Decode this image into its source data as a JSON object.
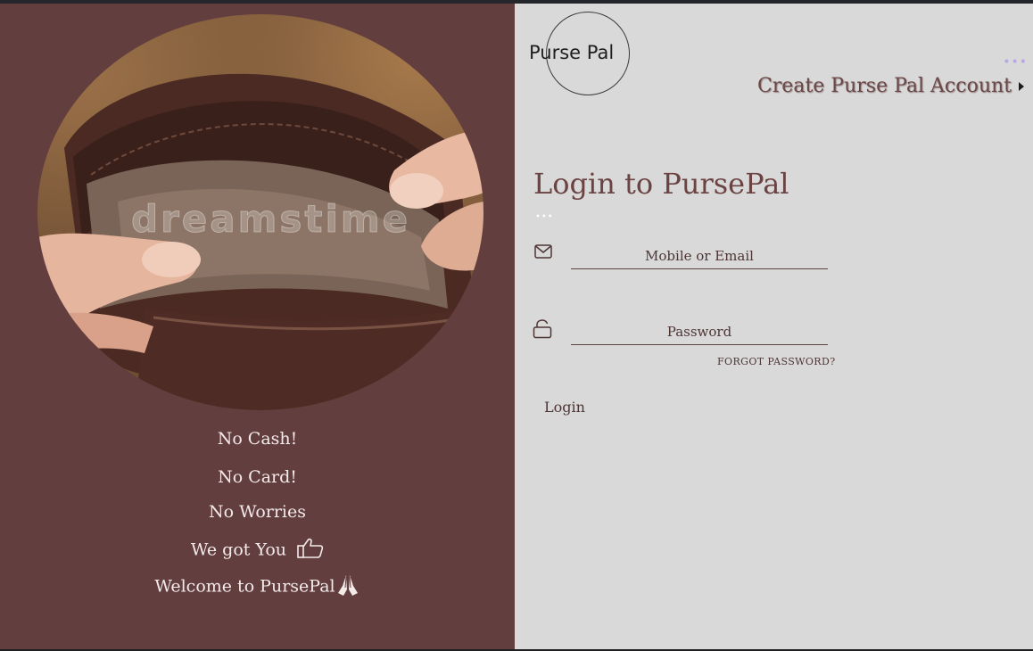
{
  "brand": {
    "logo_text": "Purse Pal"
  },
  "header": {
    "create_account_label": "Create Purse Pal Account"
  },
  "hero": {
    "watermark": "dreamstime"
  },
  "taglines": [
    "No Cash!",
    "No Card!",
    "No Worries",
    "We got You",
    "Welcome to PursePal"
  ],
  "login": {
    "title": "Login to PursePal",
    "email_placeholder": "Mobile or Email",
    "password_placeholder": "Password",
    "forgot_label": "FORGOT PASSWORD?",
    "submit_label": "Login"
  },
  "colors": {
    "left_panel": "#633e3f",
    "right_panel": "#d9d9d9",
    "accent_text": "#6b4343"
  },
  "icons": [
    "mail-icon",
    "lock-icon",
    "thumbs-up-icon",
    "praying-hands-icon",
    "chevron-right-icon"
  ]
}
